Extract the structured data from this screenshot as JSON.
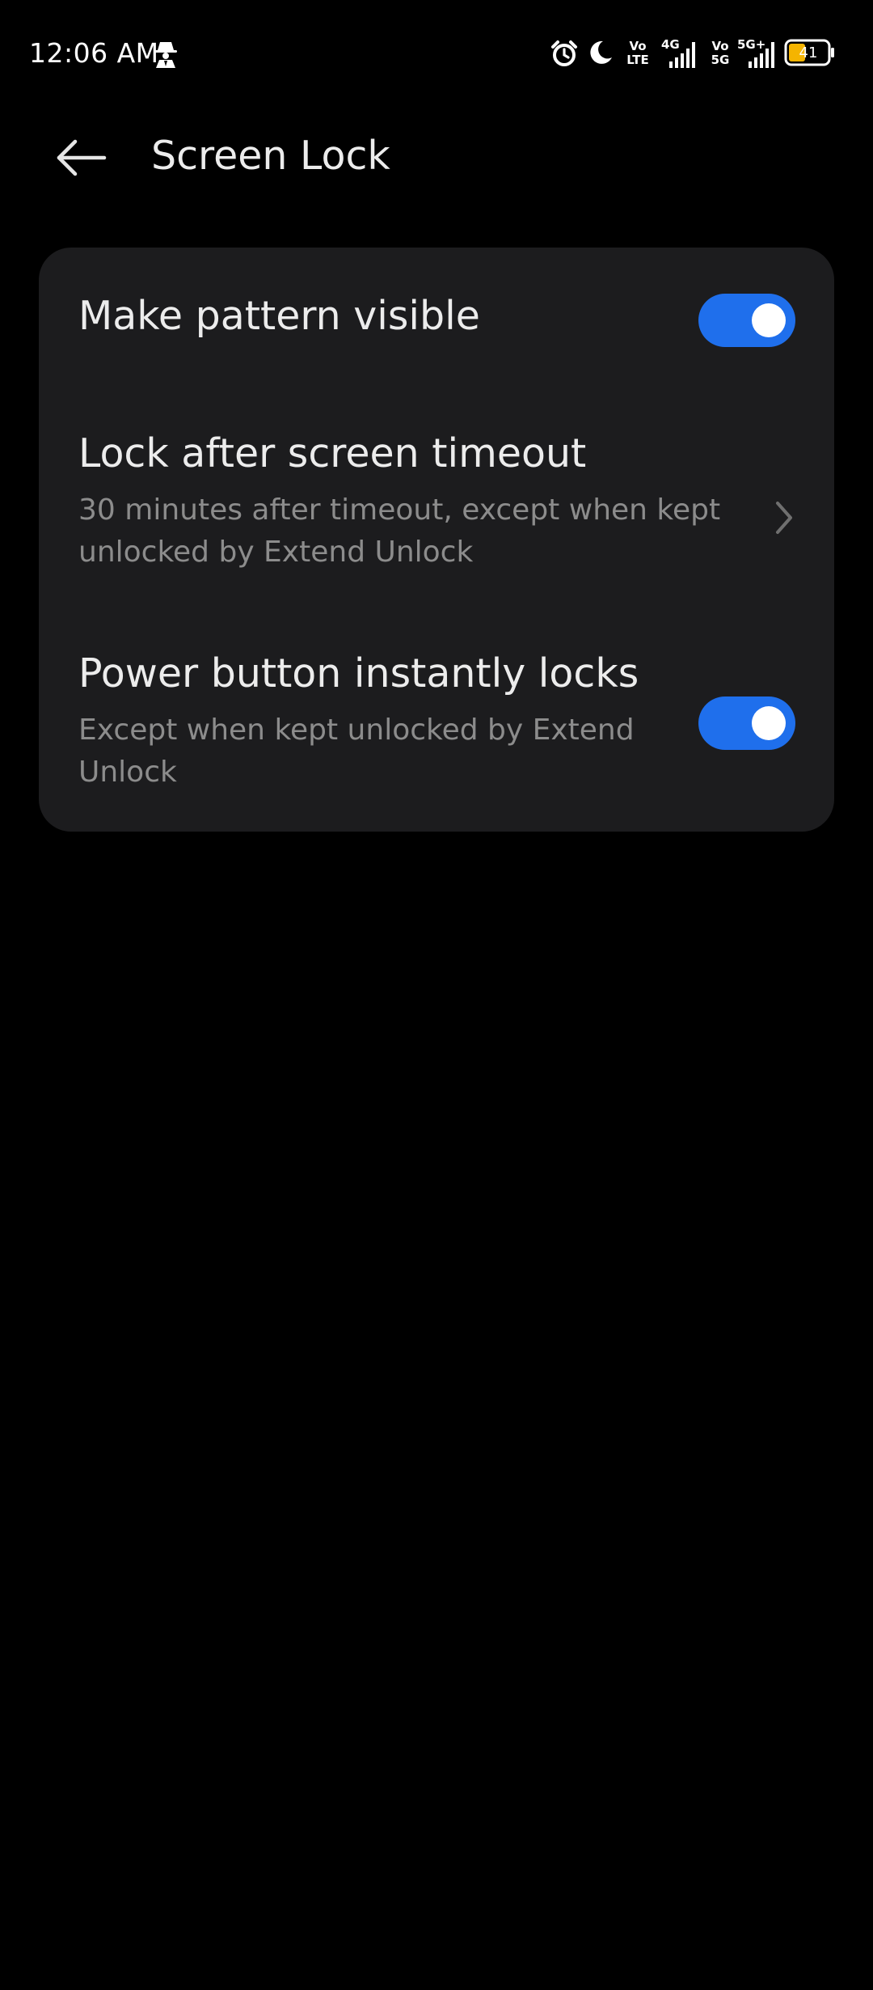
{
  "status_bar": {
    "time": "12:06 AM",
    "icons": [
      "incognito-icon",
      "alarm-icon",
      "moon-icon",
      "volte-icon",
      "signal-4g-icon",
      "vo5g-icon",
      "signal-5g-plus-icon",
      "battery-icon"
    ],
    "volte_line1": "Vo",
    "volte_line2": "LTE",
    "net1_label": "4G",
    "vo5g_line1": "Vo",
    "vo5g_line2": "5G",
    "net2_label": "5G+",
    "battery_level": "41",
    "battery_color": "#f5b400"
  },
  "header": {
    "title": "Screen Lock"
  },
  "settings": {
    "pattern_visible": {
      "title": "Make pattern visible",
      "enabled": true
    },
    "lock_after_timeout": {
      "title": "Lock after screen timeout",
      "subtitle": "30 minutes after timeout, except when kept unlocked by Extend Unlock"
    },
    "power_button_locks": {
      "title": "Power button instantly locks",
      "subtitle": "Except when kept unlocked by Extend Unlock",
      "enabled": true
    }
  },
  "colors": {
    "accent": "#1f6fec",
    "card_background": "#1c1c1e",
    "page_background": "#000000"
  }
}
